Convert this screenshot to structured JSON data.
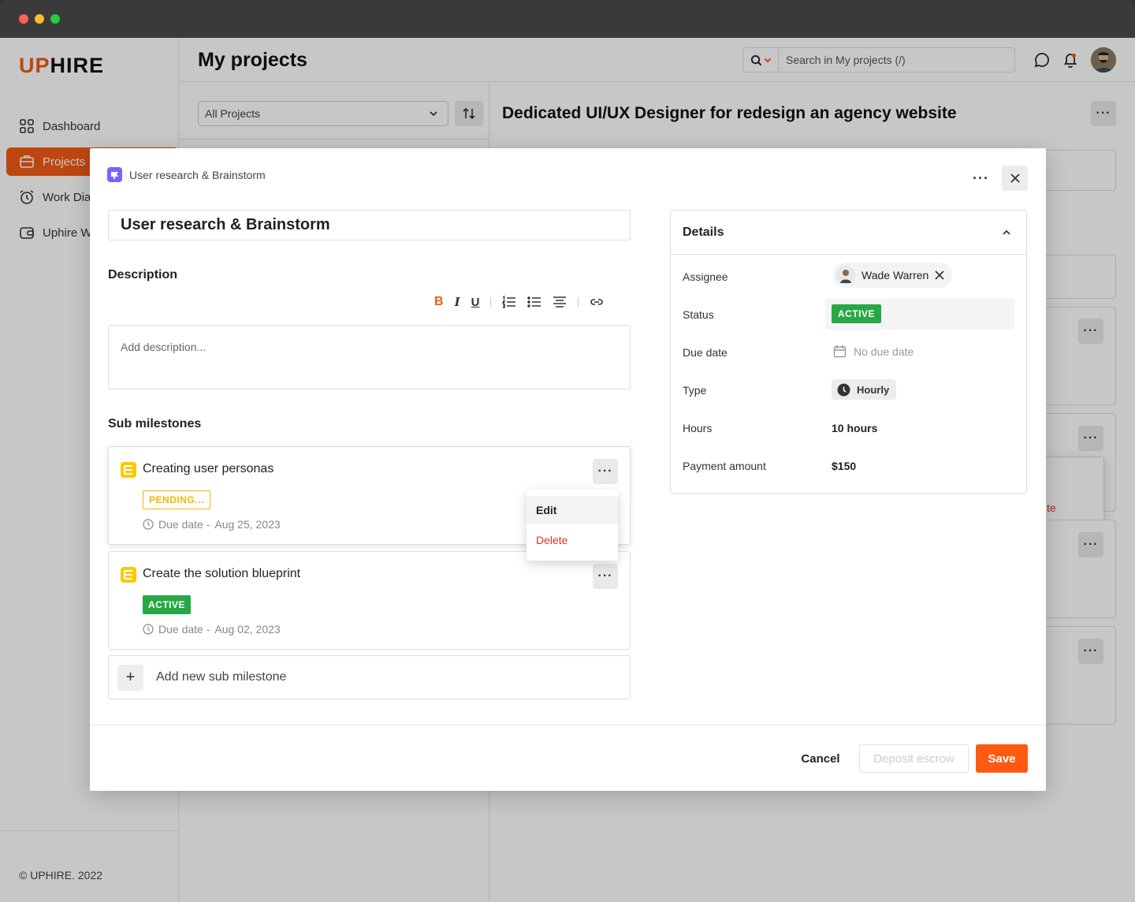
{
  "app": {
    "logo_accent": "UP",
    "logo_rest": "HIRE",
    "page_title": "My projects",
    "search_placeholder": "Search in My projects (/)",
    "copyright": "© UPHIRE. 2022",
    "brand_color": "#f25a15"
  },
  "sidebar": {
    "items": [
      {
        "label": "Dashboard",
        "icon": "grid-icon"
      },
      {
        "label": "Projects",
        "icon": "briefcase-icon"
      },
      {
        "label": "Work Dia",
        "icon": "alarm-clock-icon"
      },
      {
        "label": "Uphire W",
        "icon": "wallet-icon"
      }
    ]
  },
  "left_pane": {
    "filter_value": "All Projects"
  },
  "right_pane": {
    "title": "Dedicated UI/UX Designer for redesign an agency website",
    "partial_menu_text": "te"
  },
  "modal": {
    "breadcrumb": "User research & Brainstorm",
    "name": "User research & Brainstorm",
    "description_label": "Description",
    "description_placeholder": "Add description...",
    "sub_milestones_label": "Sub milestones",
    "sub_milestones": [
      {
        "title": "Creating user personas",
        "status": "PENDING...",
        "due_label": "Due date -",
        "due_date": "Aug 25, 2023"
      },
      {
        "title": "Create the solution blueprint",
        "status": "ACTIVE",
        "due_label": "Due date -",
        "due_date": "Aug 02, 2023"
      }
    ],
    "context_menu": {
      "edit": "Edit",
      "delete": "Delete"
    },
    "add_sub_label": "Add new sub milestone",
    "details": {
      "title": "Details",
      "assignee_label": "Assignee",
      "assignee": "Wade Warren",
      "status_label": "Status",
      "status": "ACTIVE",
      "due_label": "Due date",
      "due_value": "No due date",
      "type_label": "Type",
      "type_value": "Hourly",
      "hours_label": "Hours",
      "hours_value": "10 hours",
      "payment_label": "Payment amount",
      "payment_value": "$150"
    },
    "buttons": {
      "cancel": "Cancel",
      "deposit": "Deposit escrow",
      "save": "Save"
    }
  }
}
